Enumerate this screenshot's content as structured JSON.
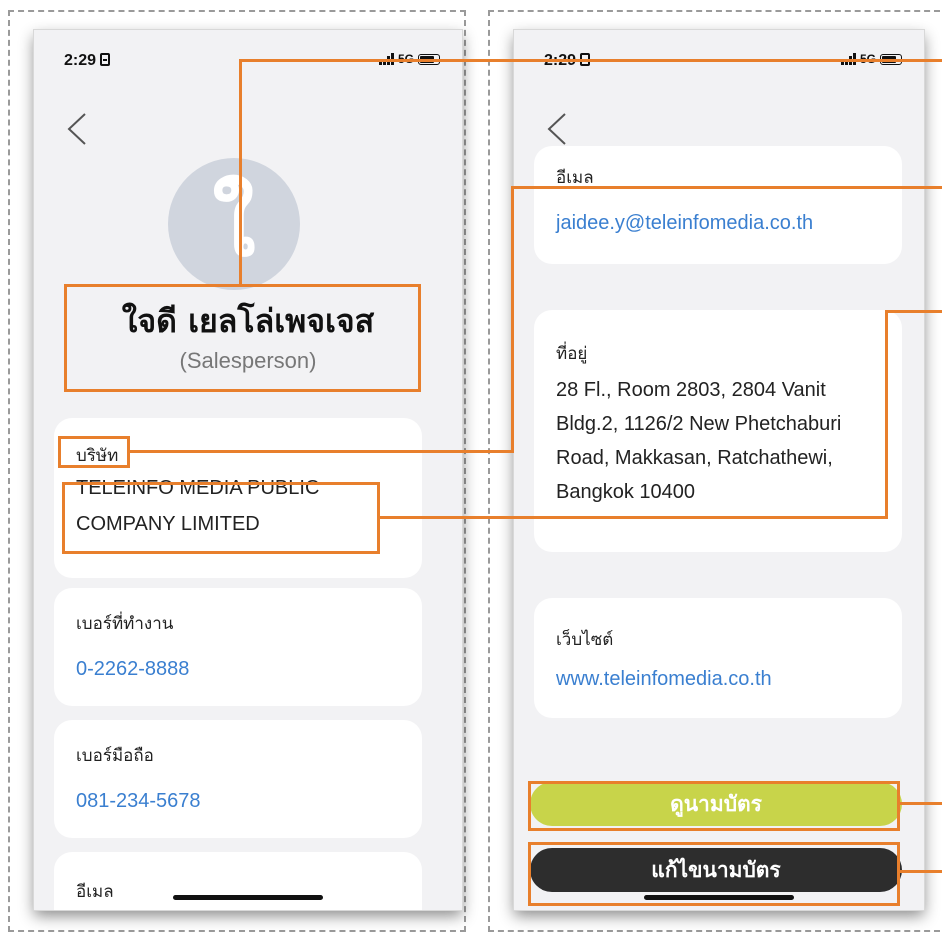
{
  "status_bar": {
    "time": "2:29",
    "network": "5G"
  },
  "profile": {
    "avatar_initial": "ใ",
    "name": "ใจดี เยลโล่เพจเจส",
    "role": "(Salesperson)"
  },
  "cards": {
    "company": {
      "label": "บริษัท",
      "line1": "TELEINFO MEDIA PUBLIC",
      "line2": "COMPANY LIMITED"
    },
    "work_phone": {
      "label": "เบอร์ที่ทำงาน",
      "value": "0-2262-8888"
    },
    "mobile_phone": {
      "label": "เบอร์มือถือ",
      "value": "081-234-5678"
    },
    "email": {
      "label": "อีเมล",
      "value": "jaidee.y@teleinfomedia.co.th"
    },
    "address": {
      "label": "ที่อยู่",
      "line1": "28 Fl., Room 2803, 2804 Vanit",
      "line2": "Bldg.2, 1126/2 New Phetchaburi",
      "line3": "Road, Makkasan, Ratchathewi,",
      "line4": "Bangkok 10400"
    },
    "website": {
      "label": "เว็บไซต์",
      "value": "www.teleinfomedia.co.th"
    }
  },
  "buttons": {
    "view_card": "ดูนามบัตร",
    "edit_card": "แก้ไขนามบัตร"
  },
  "colors": {
    "accent_callout": "#e87f2c",
    "link": "#3a7fd0",
    "view_button": "#c8d44a",
    "edit_button": "#2d2d2d"
  }
}
